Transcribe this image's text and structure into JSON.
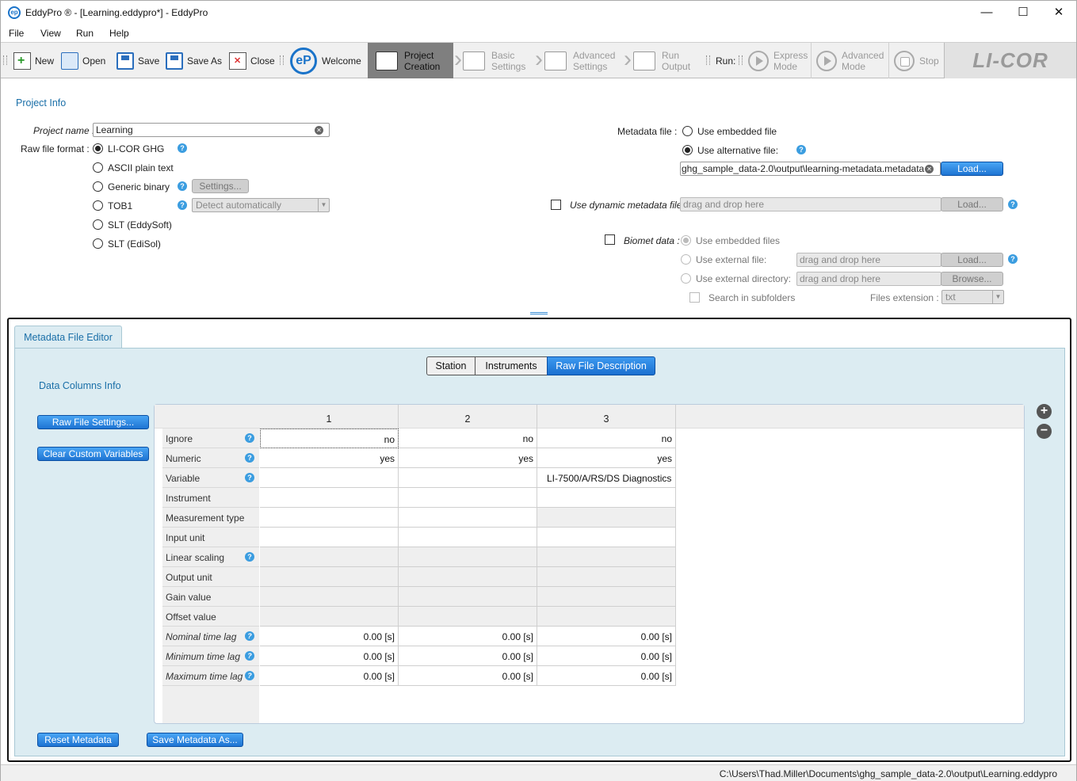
{
  "window": {
    "title": "EddyPro ® - [Learning.eddypro*] - EddyPro",
    "icon": "eddypro-logo-icon"
  },
  "menu": [
    "File",
    "View",
    "Run",
    "Help"
  ],
  "toolbar": {
    "file_buttons": [
      {
        "label": "New",
        "icon": "new-file-icon"
      },
      {
        "label": "Open",
        "icon": "open-folder-icon"
      },
      {
        "label": "Save",
        "icon": "save-icon"
      },
      {
        "label": "Save As",
        "icon": "save-as-icon"
      },
      {
        "label": "Close",
        "icon": "close-file-icon"
      }
    ],
    "welcome": "Welcome",
    "stages": [
      {
        "label1": "Project",
        "label2": "Creation",
        "state": "active"
      },
      {
        "label1": "Basic",
        "label2": "Settings",
        "state": "disabled"
      },
      {
        "label1": "Advanced",
        "label2": "Settings",
        "state": "disabled"
      },
      {
        "label1": "Run",
        "label2": "Output",
        "state": "disabled"
      }
    ],
    "run_label": "Run:",
    "run_buttons": [
      {
        "label1": "Express",
        "label2": "Mode"
      },
      {
        "label1": "Advanced",
        "label2": "Mode"
      },
      {
        "label1": "Stop",
        "label2": ""
      }
    ],
    "brand": "LI-COR"
  },
  "project_info": {
    "section": "Project Info",
    "project_name_label": "Project name :",
    "project_name": "Learning",
    "raw_format_label": "Raw file format :",
    "formats": [
      "LI-COR GHG",
      "ASCII plain text",
      "Generic binary",
      "TOB1",
      "SLT (EddySoft)",
      "SLT (EdiSol)"
    ],
    "settings_button": "Settings...",
    "tob1_combo": "Detect automatically"
  },
  "metadata": {
    "label": "Metadata file :",
    "use_embedded": "Use embedded file",
    "use_alternative": "Use alternative file:",
    "alt_path": "ghg_sample_data-2.0\\output\\learning-metadata.metadata",
    "load": "Load...",
    "dynamic_label": "Use dynamic metadata file :",
    "drag_drop": "drag and drop here",
    "biomet_label": "Biomet data :",
    "biomet_embedded": "Use embedded files",
    "biomet_external_file": "Use external file:",
    "biomet_external_dir": "Use external directory:",
    "browse": "Browse...",
    "search_subfolders": "Search in subfolders",
    "files_extension_label": "Files extension :",
    "files_extension": "txt"
  },
  "editor": {
    "tab": "Metadata File Editor",
    "segments": [
      "Station",
      "Instruments",
      "Raw File Description"
    ],
    "section": "Data Columns Info",
    "raw_file_settings": "Raw File Settings...",
    "clear_custom": "Clear Custom Variables",
    "reset": "Reset Metadata",
    "save_as": "Save Metadata As...",
    "columns": [
      "1",
      "2",
      "3"
    ],
    "rows": [
      {
        "label": "Ignore",
        "help": true,
        "italic": false,
        "cells": [
          "no",
          "no",
          "no"
        ]
      },
      {
        "label": "Numeric",
        "help": true,
        "italic": false,
        "cells": [
          "yes",
          "yes",
          "yes"
        ]
      },
      {
        "label": "Variable",
        "help": true,
        "italic": false,
        "cells": [
          "",
          "",
          "LI-7500/A/RS/DS Diagnostics"
        ]
      },
      {
        "label": "Instrument",
        "help": false,
        "italic": false,
        "cells": [
          "",
          "",
          ""
        ]
      },
      {
        "label": "Measurement type",
        "help": false,
        "italic": false,
        "cells": [
          "",
          "",
          ""
        ]
      },
      {
        "label": "Input unit",
        "help": false,
        "italic": false,
        "cells": [
          "",
          "",
          ""
        ]
      },
      {
        "label": "Linear scaling",
        "help": true,
        "italic": false,
        "cells": [
          "",
          "",
          ""
        ]
      },
      {
        "label": "Output unit",
        "help": false,
        "italic": false,
        "cells": [
          "",
          "",
          ""
        ]
      },
      {
        "label": "Gain value",
        "help": false,
        "italic": false,
        "cells": [
          "",
          "",
          ""
        ]
      },
      {
        "label": "Offset value",
        "help": false,
        "italic": false,
        "cells": [
          "",
          "",
          ""
        ]
      },
      {
        "label": "Nominal time lag",
        "help": true,
        "italic": true,
        "cells": [
          "0.00 [s]",
          "0.00 [s]",
          "0.00 [s]"
        ]
      },
      {
        "label": "Minimum time lag",
        "help": true,
        "italic": true,
        "cells": [
          "0.00 [s]",
          "0.00 [s]",
          "0.00 [s]"
        ]
      },
      {
        "label": "Maximum time lag",
        "help": true,
        "italic": true,
        "cells": [
          "0.00 [s]",
          "0.00 [s]",
          "0.00 [s]"
        ]
      }
    ]
  },
  "status": "C:\\Users\\Thad.Miller\\Documents\\ghg_sample_data-2.0\\output\\Learning.eddypro"
}
